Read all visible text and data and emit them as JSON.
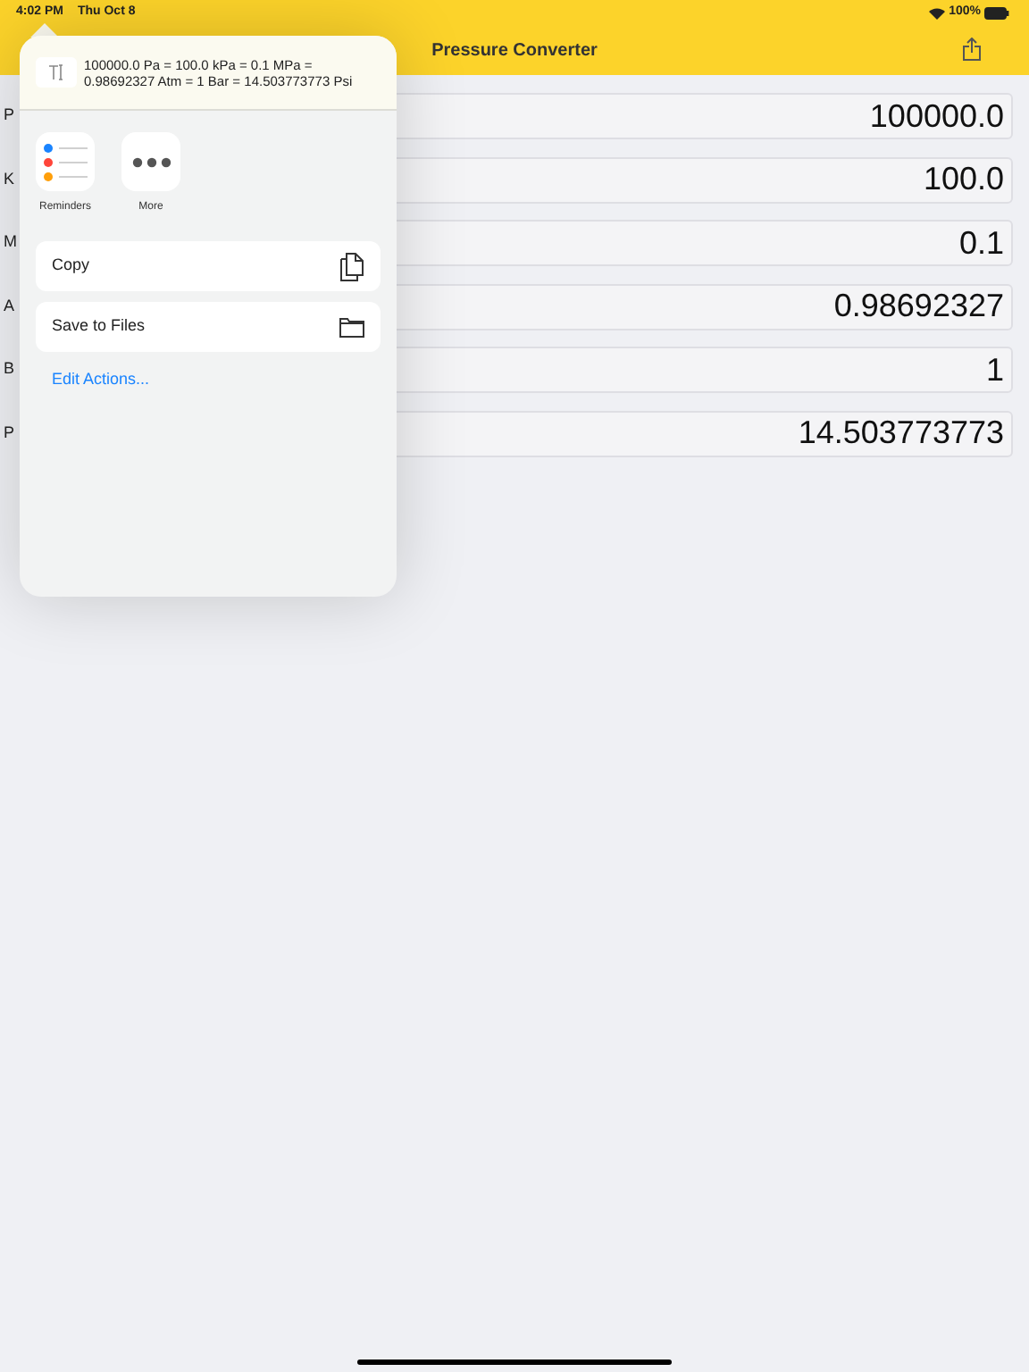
{
  "status_bar": {
    "time": "4:02 PM",
    "date": "Thu Oct 8",
    "battery": "100%"
  },
  "nav_bar": {
    "title": "Pressure Converter"
  },
  "rows": [
    {
      "label": "P",
      "value": "100000.0"
    },
    {
      "label": "K",
      "value": "100.0"
    },
    {
      "label": "M",
      "value": "0.1"
    },
    {
      "label": "A",
      "value": "0.98692327"
    },
    {
      "label": "B",
      "value": "1"
    },
    {
      "label": "P",
      "value": "14.503773773"
    }
  ],
  "share_sheet": {
    "preview_text": "100000.0 Pa = 100.0 kPa = 0.1 MPa = 0.98692327 Atm = 1 Bar = 14.503773773 Psi",
    "apps": [
      {
        "kind": "reminders",
        "label": "Reminders"
      },
      {
        "kind": "more",
        "label": "More"
      }
    ],
    "actions": [
      {
        "kind": "copy",
        "label": "Copy"
      },
      {
        "kind": "files",
        "label": "Save to Files"
      }
    ],
    "edit_link": "Edit Actions..."
  }
}
